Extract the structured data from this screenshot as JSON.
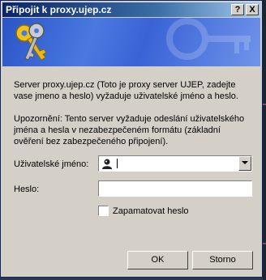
{
  "window": {
    "title": "Připojit k proxy.ujep.cz",
    "help_label": "?",
    "close_label": "X"
  },
  "dialog": {
    "message": "Server proxy.ujep.cz (Toto je proxy server UJEP, zadejte vase jmeno a heslo) vyžaduje uživatelské jméno a heslo.",
    "warning": "Upozornění: Tento server vyžaduje odeslání uživatelského jména a hesla v nezabezpečeném formátu (základní ověření bez zabezpečeného připojení).",
    "username_label": "Uživatelské jméno:",
    "username_value": "",
    "password_label": "Heslo:",
    "password_value": "",
    "remember_label": "Zapamatovat heslo",
    "remember_checked": false,
    "ok_label": "OK",
    "cancel_label": "Storno"
  },
  "icons": {
    "banner": "keys-icon",
    "user": "user-icon",
    "dropdown": "chevron-down-icon"
  }
}
